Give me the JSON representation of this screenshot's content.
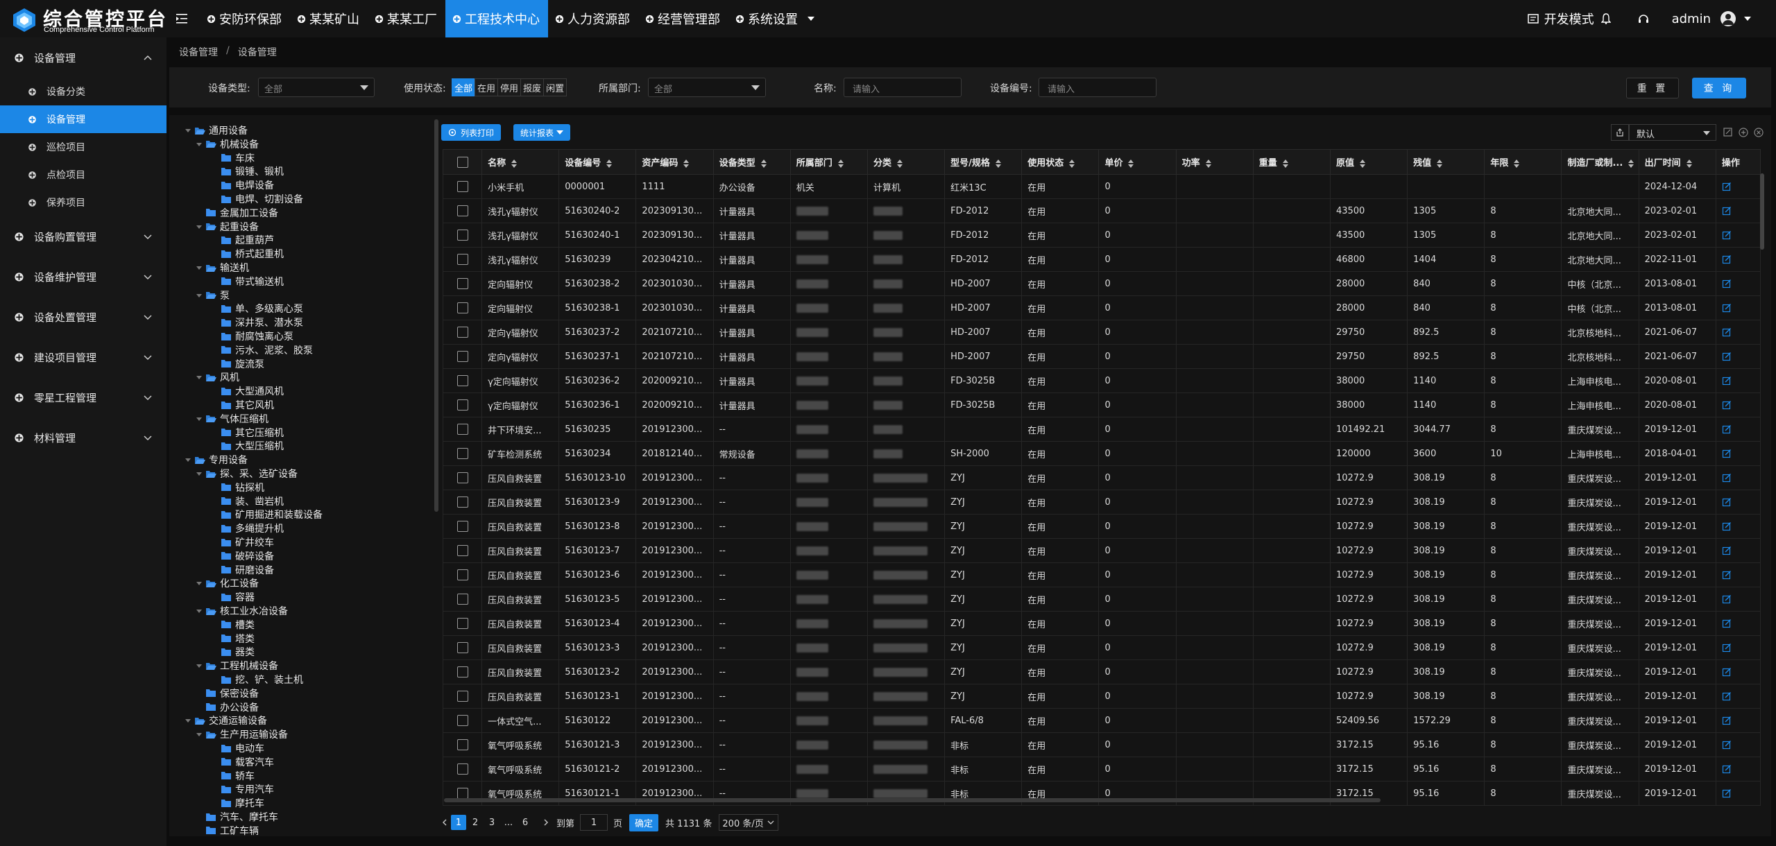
{
  "app": {
    "title": "综合管控平台",
    "subtitle": "Comprehensive Control Platform"
  },
  "topnav": [
    {
      "label": "安防环保部"
    },
    {
      "label": "某某矿山"
    },
    {
      "label": "某某工厂"
    },
    {
      "label": "工程技术中心",
      "active": true
    },
    {
      "label": "人力资源部"
    },
    {
      "label": "经营管理部"
    },
    {
      "label": "系统设置",
      "dropdown": true
    }
  ],
  "header_right": {
    "devmode": "开发模式",
    "user": "admin"
  },
  "sidebar": {
    "groups": [
      {
        "label": "设备管理",
        "expanded": true,
        "children": [
          {
            "label": "设备分类"
          },
          {
            "label": "设备管理",
            "active": true
          },
          {
            "label": "巡检项目"
          },
          {
            "label": "点检项目"
          },
          {
            "label": "保养项目"
          }
        ]
      },
      {
        "label": "设备购置管理"
      },
      {
        "label": "设备维护管理"
      },
      {
        "label": "设备处置管理"
      },
      {
        "label": "建设项目管理"
      },
      {
        "label": "零星工程管理"
      },
      {
        "label": "材料管理"
      }
    ]
  },
  "breadcrumb": [
    "设备管理",
    "设备管理"
  ],
  "filters": {
    "type_label": "设备类型:",
    "type_value": "全部",
    "status_label": "使用状态:",
    "status_options": [
      "全部",
      "在用",
      "停用",
      "报废",
      "闲置"
    ],
    "dept_label": "所属部门:",
    "dept_value": "全部",
    "name_label": "名称:",
    "name_placeholder": "请输入",
    "code_label": "设备编号:",
    "code_placeholder": "请输入",
    "reset": "重 置",
    "query": "查 询"
  },
  "tree": [
    {
      "label": "通用设备",
      "level": 0,
      "expanded": true
    },
    {
      "label": "机械设备",
      "level": 1,
      "expanded": true
    },
    {
      "label": "车床",
      "level": 2
    },
    {
      "label": "锻锤、锻机",
      "level": 2
    },
    {
      "label": "电焊设备",
      "level": 2
    },
    {
      "label": "电焊、切割设备",
      "level": 2
    },
    {
      "label": "金属加工设备",
      "level": 1
    },
    {
      "label": "起重设备",
      "level": 1,
      "expanded": true
    },
    {
      "label": "起重葫芦",
      "level": 2
    },
    {
      "label": "桥式起重机",
      "level": 2
    },
    {
      "label": "输送机",
      "level": 1,
      "expanded": true
    },
    {
      "label": "带式输送机",
      "level": 2
    },
    {
      "label": "泵",
      "level": 1,
      "expanded": true
    },
    {
      "label": "单、多级离心泵",
      "level": 2
    },
    {
      "label": "深井泵、潜水泵",
      "level": 2
    },
    {
      "label": "耐腐蚀离心泵",
      "level": 2
    },
    {
      "label": "污水、泥浆、胶泵",
      "level": 2
    },
    {
      "label": "旋流泵",
      "level": 2
    },
    {
      "label": "风机",
      "level": 1,
      "expanded": true
    },
    {
      "label": "大型通风机",
      "level": 2
    },
    {
      "label": "其它风机",
      "level": 2
    },
    {
      "label": "气体压缩机",
      "level": 1,
      "expanded": true
    },
    {
      "label": "其它压缩机",
      "level": 2
    },
    {
      "label": "大型压缩机",
      "level": 2
    },
    {
      "label": "专用设备",
      "level": 0,
      "expanded": true
    },
    {
      "label": "探、采、选矿设备",
      "level": 1,
      "expanded": true
    },
    {
      "label": "钻探机",
      "level": 2
    },
    {
      "label": "装、凿岩机",
      "level": 2
    },
    {
      "label": "矿用掘进和装载设备",
      "level": 2
    },
    {
      "label": "多绳提升机",
      "level": 2
    },
    {
      "label": "矿井绞车",
      "level": 2
    },
    {
      "label": "破碎设备",
      "level": 2
    },
    {
      "label": "研磨设备",
      "level": 2
    },
    {
      "label": "化工设备",
      "level": 1,
      "expanded": true
    },
    {
      "label": "容器",
      "level": 2
    },
    {
      "label": "核工业水冶设备",
      "level": 1,
      "expanded": true
    },
    {
      "label": "槽类",
      "level": 2
    },
    {
      "label": "塔类",
      "level": 2
    },
    {
      "label": "器类",
      "level": 2
    },
    {
      "label": "工程机械设备",
      "level": 1,
      "expanded": true
    },
    {
      "label": "挖、铲、装土机",
      "level": 2
    },
    {
      "label": "保密设备",
      "level": 1
    },
    {
      "label": "办公设备",
      "level": 1
    },
    {
      "label": "交通运输设备",
      "level": 0,
      "expanded": true
    },
    {
      "label": "生产用运输设备",
      "level": 1,
      "expanded": true
    },
    {
      "label": "电动车",
      "level": 2
    },
    {
      "label": "载客汽车",
      "level": 2
    },
    {
      "label": "轿车",
      "level": 2
    },
    {
      "label": "专用汽车",
      "level": 2
    },
    {
      "label": "摩托车",
      "level": 2
    },
    {
      "label": "汽车、摩托车",
      "level": 1
    },
    {
      "label": "工矿车辆",
      "level": 1
    }
  ],
  "toolbar": {
    "print": "列表打印",
    "report": "统计报表",
    "view": "默认"
  },
  "table": {
    "columns": [
      "名称",
      "设备编号",
      "资产编码",
      "设备类型",
      "所属部门",
      "分类",
      "型号/规格",
      "使用状态",
      "单价",
      "功率",
      "重量",
      "原值",
      "残值",
      "年限",
      "制造厂或制...",
      "出厂时间",
      "操作"
    ],
    "rows": [
      [
        "小米手机",
        "0000001",
        "1111",
        "办公设备",
        "机关",
        "计算机",
        "红米13C",
        "在用",
        "0",
        "",
        "",
        "",
        "",
        "",
        "",
        "2024-12-04"
      ],
      [
        "浅孔γ辐射仪",
        "51630240-2",
        "202309130...",
        "计量器具",
        "",
        "",
        "FD-2012",
        "在用",
        "0",
        "",
        "",
        "43500",
        "1305",
        "8",
        "北京地大同...",
        "2023-02-01"
      ],
      [
        "浅孔γ辐射仪",
        "51630240-1",
        "202309130...",
        "计量器具",
        "",
        "",
        "FD-2012",
        "在用",
        "0",
        "",
        "",
        "43500",
        "1305",
        "8",
        "北京地大同...",
        "2023-02-01"
      ],
      [
        "浅孔γ辐射仪",
        "51630239",
        "202304210...",
        "计量器具",
        "",
        "",
        "FD-2012",
        "在用",
        "0",
        "",
        "",
        "46800",
        "1404",
        "8",
        "北京地大同...",
        "2022-11-01"
      ],
      [
        "定向辐射仪",
        "51630238-2",
        "202301030...",
        "计量器具",
        "",
        "",
        "HD-2007",
        "在用",
        "0",
        "",
        "",
        "28000",
        "840",
        "8",
        "中核（北京...",
        "2013-08-01"
      ],
      [
        "定向辐射仪",
        "51630238-1",
        "202301030...",
        "计量器具",
        "",
        "",
        "HD-2007",
        "在用",
        "0",
        "",
        "",
        "28000",
        "840",
        "8",
        "中核（北京...",
        "2013-08-01"
      ],
      [
        "定向γ辐射仪",
        "51630237-2",
        "202107210...",
        "计量器具",
        "",
        "",
        "HD-2007",
        "在用",
        "0",
        "",
        "",
        "29750",
        "892.5",
        "8",
        "北京核地科...",
        "2021-06-07"
      ],
      [
        "定向γ辐射仪",
        "51630237-1",
        "202107210...",
        "计量器具",
        "",
        "",
        "HD-2007",
        "在用",
        "0",
        "",
        "",
        "29750",
        "892.5",
        "8",
        "北京核地科...",
        "2021-06-07"
      ],
      [
        "γ定向辐射仪",
        "51630236-2",
        "202009210...",
        "计量器具",
        "",
        "",
        "FD-3025B",
        "在用",
        "0",
        "",
        "",
        "38000",
        "1140",
        "8",
        "上海申核电...",
        "2020-08-01"
      ],
      [
        "γ定向辐射仪",
        "51630236-1",
        "202009210...",
        "计量器具",
        "",
        "",
        "FD-3025B",
        "在用",
        "0",
        "",
        "",
        "38000",
        "1140",
        "8",
        "上海申核电...",
        "2020-08-01"
      ],
      [
        "井下环境安...",
        "51630235",
        "201912300...",
        "--",
        "",
        "",
        "",
        "在用",
        "0",
        "",
        "",
        "101492.21",
        "3044.77",
        "8",
        "重庆煤炭设...",
        "2019-12-01"
      ],
      [
        "矿车检测系统",
        "51630234",
        "201812140...",
        "常规设备",
        "",
        "",
        "SH-2000",
        "在用",
        "0",
        "",
        "",
        "120000",
        "3600",
        "10",
        "上海申核电...",
        "2018-04-01"
      ],
      [
        "压风自救装置",
        "51630123-10",
        "201912300...",
        "--",
        "",
        "",
        "ZYJ",
        "在用",
        "0",
        "",
        "",
        "10272.9",
        "308.19",
        "8",
        "重庆煤炭设...",
        "2019-12-01"
      ],
      [
        "压风自救装置",
        "51630123-9",
        "201912300...",
        "--",
        "",
        "",
        "ZYJ",
        "在用",
        "0",
        "",
        "",
        "10272.9",
        "308.19",
        "8",
        "重庆煤炭设...",
        "2019-12-01"
      ],
      [
        "压风自救装置",
        "51630123-8",
        "201912300...",
        "--",
        "",
        "",
        "ZYJ",
        "在用",
        "0",
        "",
        "",
        "10272.9",
        "308.19",
        "8",
        "重庆煤炭设...",
        "2019-12-01"
      ],
      [
        "压风自救装置",
        "51630123-7",
        "201912300...",
        "--",
        "",
        "",
        "ZYJ",
        "在用",
        "0",
        "",
        "",
        "10272.9",
        "308.19",
        "8",
        "重庆煤炭设...",
        "2019-12-01"
      ],
      [
        "压风自救装置",
        "51630123-6",
        "201912300...",
        "--",
        "",
        "",
        "ZYJ",
        "在用",
        "0",
        "",
        "",
        "10272.9",
        "308.19",
        "8",
        "重庆煤炭设...",
        "2019-12-01"
      ],
      [
        "压风自救装置",
        "51630123-5",
        "201912300...",
        "--",
        "",
        "",
        "ZYJ",
        "在用",
        "0",
        "",
        "",
        "10272.9",
        "308.19",
        "8",
        "重庆煤炭设...",
        "2019-12-01"
      ],
      [
        "压风自救装置",
        "51630123-4",
        "201912300...",
        "--",
        "",
        "",
        "ZYJ",
        "在用",
        "0",
        "",
        "",
        "10272.9",
        "308.19",
        "8",
        "重庆煤炭设...",
        "2019-12-01"
      ],
      [
        "压风自救装置",
        "51630123-3",
        "201912300...",
        "--",
        "",
        "",
        "ZYJ",
        "在用",
        "0",
        "",
        "",
        "10272.9",
        "308.19",
        "8",
        "重庆煤炭设...",
        "2019-12-01"
      ],
      [
        "压风自救装置",
        "51630123-2",
        "201912300...",
        "--",
        "",
        "",
        "ZYJ",
        "在用",
        "0",
        "",
        "",
        "10272.9",
        "308.19",
        "8",
        "重庆煤炭设...",
        "2019-12-01"
      ],
      [
        "压风自救装置",
        "51630123-1",
        "201912300...",
        "--",
        "",
        "",
        "ZYJ",
        "在用",
        "0",
        "",
        "",
        "10272.9",
        "308.19",
        "8",
        "重庆煤炭设...",
        "2019-12-01"
      ],
      [
        "一体式空气...",
        "51630122",
        "201912300...",
        "--",
        "",
        "",
        "FAL-6/8",
        "在用",
        "0",
        "",
        "",
        "52409.56",
        "1572.29",
        "8",
        "重庆煤炭设...",
        "2019-12-01"
      ],
      [
        "氧气呼吸系统",
        "51630121-3",
        "201912300...",
        "--",
        "",
        "",
        "非标",
        "在用",
        "0",
        "",
        "",
        "3172.15",
        "95.16",
        "8",
        "重庆煤炭设...",
        "2019-12-01"
      ],
      [
        "氧气呼吸系统",
        "51630121-2",
        "201912300...",
        "--",
        "",
        "",
        "非标",
        "在用",
        "0",
        "",
        "",
        "3172.15",
        "95.16",
        "8",
        "重庆煤炭设...",
        "2019-12-01"
      ],
      [
        "氧气呼吸系统",
        "51630121-1",
        "201912300...",
        "--",
        "",
        "",
        "非标",
        "在用",
        "0",
        "",
        "",
        "3172.15",
        "95.16",
        "8",
        "重庆煤炭设...",
        "2019-12-01"
      ]
    ]
  },
  "pager": {
    "pages": [
      "1",
      "2",
      "3",
      "...",
      "6"
    ],
    "goto_label": "到第",
    "goto_value": "1",
    "page_unit": "页",
    "confirm": "确定",
    "total": "共 1131 条",
    "page_size": "200 条/页"
  },
  "colors": {
    "accent": "#1c87e6",
    "folder": "#3b8ef0"
  }
}
